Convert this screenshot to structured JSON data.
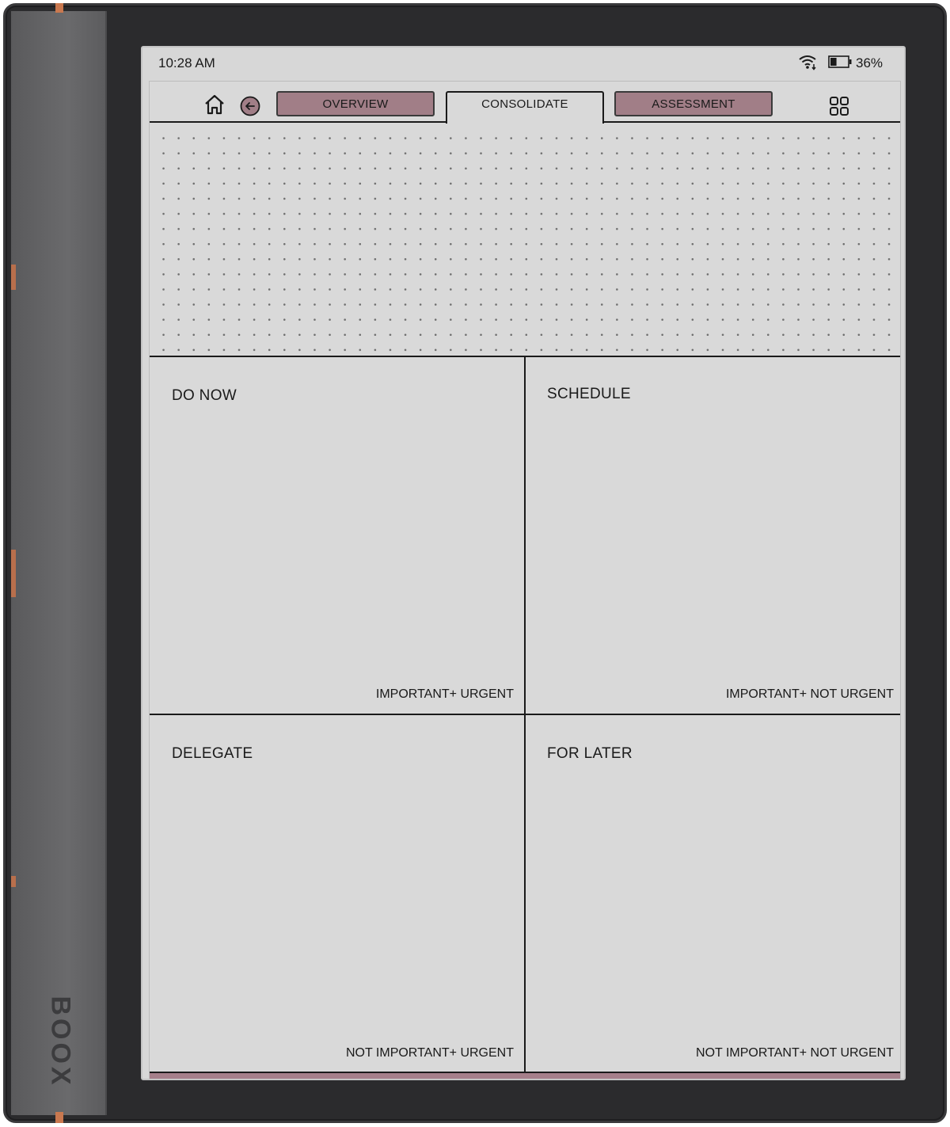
{
  "status_bar": {
    "time": "10:28 AM",
    "battery_percent": "36%",
    "battery_level": 0.36
  },
  "device": {
    "brand": "BOOX"
  },
  "toolbar": {
    "tabs": [
      {
        "label": "OVERVIEW",
        "state": "filled"
      },
      {
        "label": "CONSOLIDATE",
        "state": "active"
      },
      {
        "label": "ASSESSMENT",
        "state": "filled"
      }
    ],
    "icons": [
      "home-icon",
      "back-arrow-icon",
      "apps-grid-icon"
    ]
  },
  "matrix": {
    "quadrants": [
      {
        "title": "DO NOW",
        "note": "IMPORTANT+ URGENT"
      },
      {
        "title": "SCHEDULE",
        "note": "IMPORTANT+ NOT URGENT"
      },
      {
        "title": "DELEGATE",
        "note": "NOT IMPORTANT+ URGENT"
      },
      {
        "title": "FOR LATER",
        "note": "NOT IMPORTANT+ NOT URGENT"
      }
    ]
  },
  "colors": {
    "tab_fill": "#a17e87",
    "bottom_bar": "#a57f8a",
    "screen_bg": "#d9d9d9",
    "device_body": "#2b2b2d",
    "accent": "#c9784f"
  }
}
